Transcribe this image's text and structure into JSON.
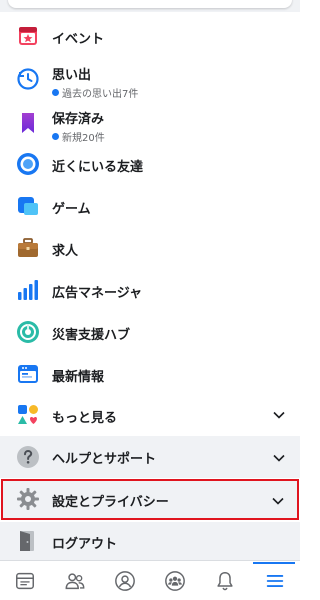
{
  "menu": {
    "events": {
      "label": "イベント"
    },
    "memories": {
      "label": "思い出",
      "sub": "過去の思い出7件"
    },
    "saved": {
      "label": "保存済み",
      "sub": "新規20件"
    },
    "nearby_friends": {
      "label": "近くにいる友達"
    },
    "gaming": {
      "label": "ゲーム"
    },
    "jobs": {
      "label": "求人"
    },
    "ads_manager": {
      "label": "広告マネージャ"
    },
    "crisis_response": {
      "label": "災害支援ハブ"
    },
    "news": {
      "label": "最新情報"
    },
    "see_more": {
      "label": "もっと見る"
    }
  },
  "sections": {
    "help": {
      "label": "ヘルプとサポート"
    },
    "settings": {
      "label": "設定とプライバシー"
    },
    "logout": {
      "label": "ログアウト"
    }
  },
  "tabbar": {
    "items": [
      {
        "icon": "news-feed-icon"
      },
      {
        "icon": "friends-icon"
      },
      {
        "icon": "profile-icon"
      },
      {
        "icon": "groups-icon"
      },
      {
        "icon": "notifications-icon"
      },
      {
        "icon": "menu-icon",
        "active": true
      }
    ]
  },
  "colors": {
    "accent": "#1877f2",
    "highlight_border": "#e0141e",
    "section_bg": "#f0f2f5",
    "unread_dot": "#1877f2"
  }
}
